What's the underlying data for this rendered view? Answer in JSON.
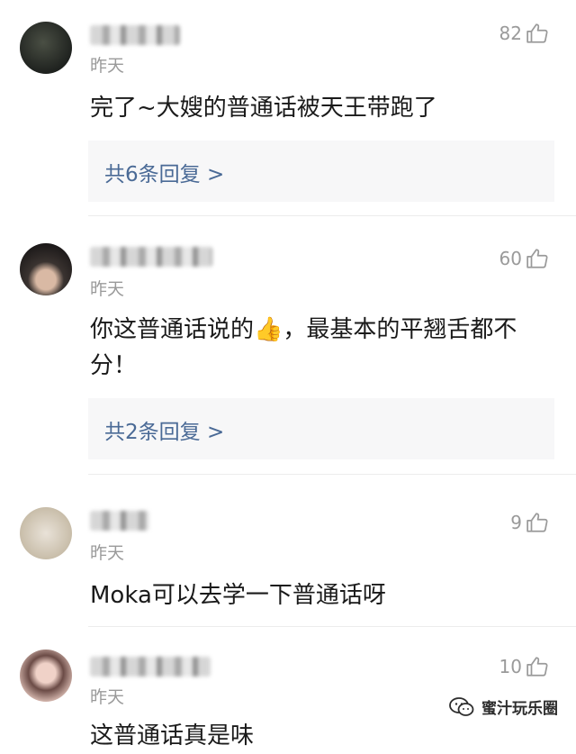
{
  "comments": [
    {
      "time": "昨天",
      "likes": "82",
      "text": "完了~大嫂的普通话被天王带跑了",
      "replies": "共6条回复 >"
    },
    {
      "time": "昨天",
      "likes": "60",
      "text": "你这普通话说的👍，最基本的平翘舌都不分！",
      "replies": "共2条回复 >"
    },
    {
      "time": "昨天",
      "likes": "9",
      "text": "Moka可以去学一下普通话呀"
    },
    {
      "time": "昨天",
      "likes": "10",
      "text": "这普通话真是味"
    }
  ],
  "watermark": {
    "text": "蜜汁玩乐圈"
  },
  "icons": {
    "like": "thumbs-up-icon",
    "watermark": "wechat-icon"
  }
}
